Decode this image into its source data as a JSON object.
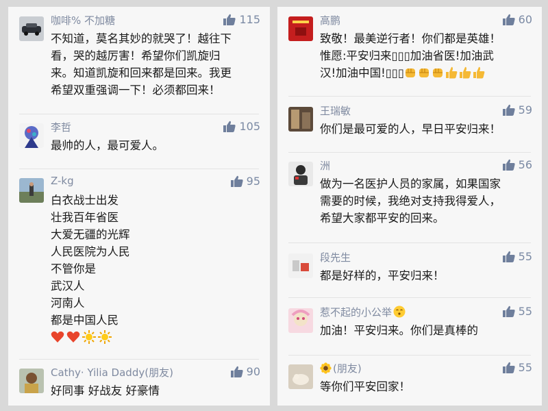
{
  "left": [
    {
      "username": "咖啡% 不加糖",
      "likes": "115",
      "lines": [
        "不知道，莫名其妙的就哭了！越往下",
        "看，哭的越厉害！希望你们凯旋归",
        "来。知道凯旋和回来都是回来。我更",
        "希望双重强调一下！必须都回来！"
      ]
    },
    {
      "username": "李哲",
      "likes": "105",
      "lines": [
        "最帅的人，最可爱人。"
      ]
    },
    {
      "username": "Z-kg",
      "likes": "95",
      "lines": [
        "白衣战士出发",
        "壮我百年省医",
        "大爱无疆的光辉",
        "人民医院为人民",
        "不管你是",
        "武汉人",
        "河南人",
        "都是中国人民"
      ],
      "emoji_line": [
        "heart-icon",
        "heart-icon",
        "sun-icon",
        "sun-icon"
      ]
    },
    {
      "username": "Cathy· Yilia Daddy(朋友)",
      "likes": "90",
      "lines": [
        "好同事 好战友 好豪情"
      ]
    }
  ],
  "right": [
    {
      "username": "高鹏",
      "likes": "60",
      "lines": [
        "致敬！最美逆行者！你们都是英雄！",
        "惟愿:平安归来▯▯▯加油省医!加油武",
        "汉!加油中国!▯▯▯"
      ],
      "line3_emojis": [
        "fist-icon",
        "fist-icon",
        "fist-icon",
        "thumbs-up-icon",
        "thumbs-up-icon",
        "thumbs-up-icon"
      ]
    },
    {
      "username": "王瑞敏",
      "likes": "59",
      "lines": [
        "你们是最可爱的人，早日平安归来！"
      ]
    },
    {
      "username": "洲",
      "likes": "56",
      "lines": [
        "做为一名医护人员的家属，如果国家",
        "需要的时候，我绝对支持我得爱人，",
        "希望大家都平安的回来。"
      ]
    },
    {
      "username": "段先生",
      "likes": "55",
      "lines": [
        "都是好样的，平安归来！"
      ]
    },
    {
      "username": "惹不起的小公举",
      "likes": "55",
      "lines": [
        "加油！平安归来。你们是真棒的"
      ],
      "name_emoji": "kiss-face-icon"
    },
    {
      "username": "(朋友)",
      "likes": "55",
      "lines": [
        "等你们平安回家！"
      ],
      "name_emoji": "sunflower-icon"
    }
  ],
  "colors": {
    "username": "#7f8aa0",
    "like_icon": "#6f7f9c",
    "text": "#1a1a1a",
    "panel_bg": "#f7f7f7",
    "background": "#d9d9d9"
  }
}
